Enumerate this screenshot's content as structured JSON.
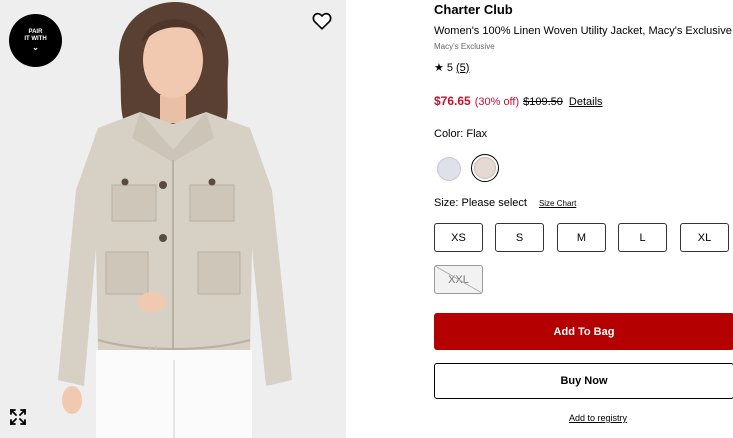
{
  "badge": {
    "line1": "PAIR",
    "line2": "IT WITH",
    "chevron": "⌄"
  },
  "icons": {
    "favorite": "heart-icon",
    "expand": "expand-icon",
    "rating_star": "star-icon"
  },
  "product": {
    "brand": "Charter Club",
    "title": "Women's 100% Linen Woven Utility Jacket, Macy's Exclusive",
    "exclusive_label": "Macy's Exclusive",
    "rating": {
      "star": "★",
      "value": "5",
      "count": "(5)"
    },
    "price": {
      "sale": "$76.65",
      "discount": "(30% off)",
      "original": "$109.50",
      "details_link": "Details"
    },
    "color": {
      "label": "Color: Flax",
      "swatches": [
        "#dfe0ea",
        "#e5d9d3"
      ],
      "selected_index": 1
    },
    "size": {
      "label": "Size: Please select",
      "chart_link": "Size Chart",
      "options": [
        {
          "label": "XS",
          "available": true
        },
        {
          "label": "S",
          "available": true
        },
        {
          "label": "M",
          "available": true
        },
        {
          "label": "L",
          "available": true
        },
        {
          "label": "XL",
          "available": true
        },
        {
          "label": "XXL",
          "available": false
        }
      ]
    },
    "actions": {
      "add_to_bag": "Add To Bag",
      "buy_now": "Buy Now",
      "add_to_registry": "Add to registry"
    }
  },
  "colors": {
    "sale_red": "#c8102e",
    "bag_button": "#b40000"
  }
}
